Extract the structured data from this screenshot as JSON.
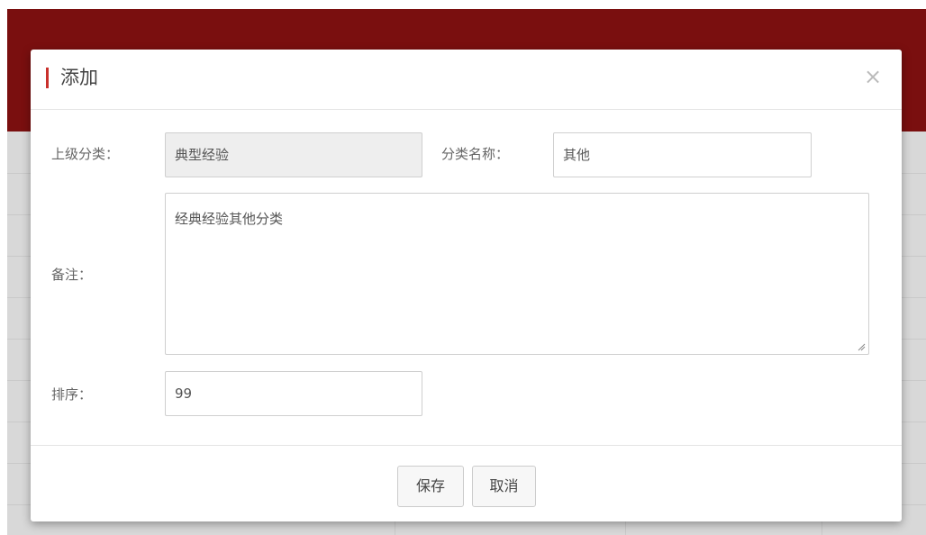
{
  "modal": {
    "title": "添加",
    "close_icon": "×"
  },
  "form": {
    "parent_category": {
      "label": "上级分类：",
      "value": "典型经验"
    },
    "category_name": {
      "label": "分类名称：",
      "value": "其他"
    },
    "remark": {
      "label": "备注：",
      "value": "经典经验其他分类"
    },
    "sort": {
      "label": "排序：",
      "value": "99"
    }
  },
  "footer": {
    "save_label": "保存",
    "cancel_label": "取消"
  },
  "colors": {
    "header_bg": "#7a0f0f",
    "title_accent": "#c9302c"
  }
}
